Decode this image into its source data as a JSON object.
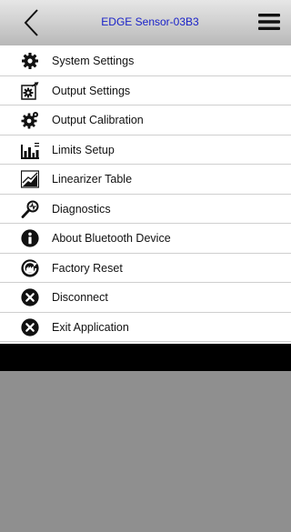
{
  "header": {
    "title": "EDGE Sensor-03B3",
    "title_color": "#1a22c8",
    "back_icon": "chevron-left-icon",
    "menu_icon": "hamburger-menu-icon"
  },
  "menu": {
    "items": [
      {
        "label": "System Settings",
        "icon": "gear-icon"
      },
      {
        "label": "Output Settings",
        "icon": "output-settings-icon"
      },
      {
        "label": "Output Calibration",
        "icon": "calibration-gear-icon"
      },
      {
        "label": "Limits Setup",
        "icon": "limits-chart-icon"
      },
      {
        "label": "Linearizer Table",
        "icon": "linearizer-chart-icon"
      },
      {
        "label": "Diagnostics",
        "icon": "diagnostics-probe-icon"
      },
      {
        "label": "About Bluetooth Device",
        "icon": "info-icon"
      },
      {
        "label": "Factory Reset",
        "icon": "factory-reset-icon"
      },
      {
        "label": "Disconnect",
        "icon": "close-circle-icon"
      },
      {
        "label": "Exit Application",
        "icon": "close-circle-icon"
      }
    ]
  }
}
